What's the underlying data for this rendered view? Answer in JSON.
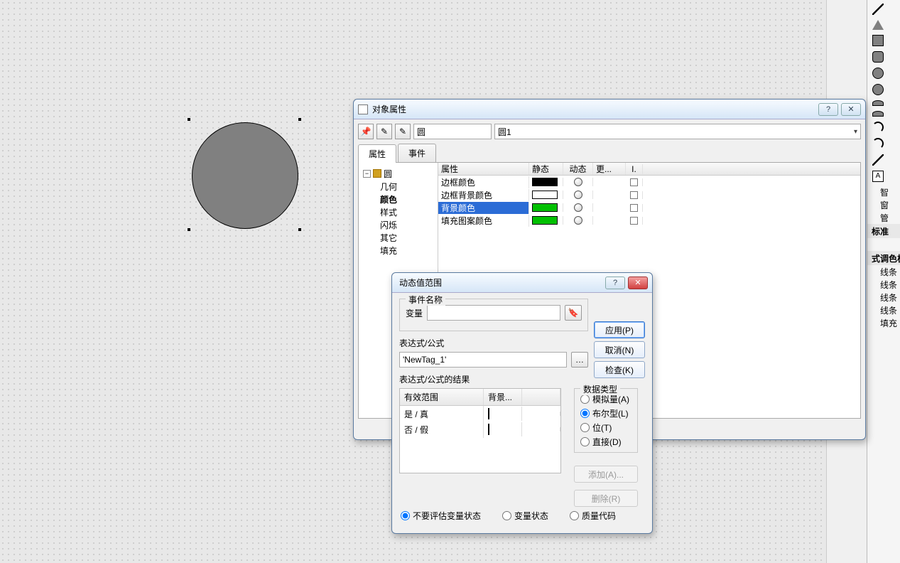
{
  "dlgProps": {
    "title": "对象属性",
    "objType": "圆",
    "objName": "圆1",
    "tabs": {
      "attr": "属性",
      "event": "事件"
    },
    "tree": {
      "root": "圆",
      "leaves": [
        "几何",
        "颜色",
        "样式",
        "闪烁",
        "其它",
        "填充"
      ],
      "selectedIndex": 1
    },
    "tableHead": {
      "prop": "属性",
      "static": "静态",
      "dyn": "动态",
      "more": "更...",
      "ind": "I."
    },
    "rows": [
      {
        "name": "边框颜色",
        "swatch": "sw-black",
        "selected": false
      },
      {
        "name": "边框背景颜色",
        "swatch": "sw-white",
        "selected": false
      },
      {
        "name": "背景颜色",
        "swatch": "sw-green",
        "selected": true
      },
      {
        "name": "填充图案颜色",
        "swatch": "sw-green",
        "selected": false
      }
    ]
  },
  "dlgDyn": {
    "title": "动态值范围",
    "eventNameLabel": "事件名称",
    "varLabel": "变量",
    "varValue": "",
    "exprLabel": "表达式/公式",
    "exprValue": "'NewTag_1'",
    "resultLegend": "表达式/公式的结果",
    "resHead": {
      "range": "有效范围",
      "bg": "背景..."
    },
    "resRows": [
      {
        "label": "是 / 真",
        "cls": "clr-red"
      },
      {
        "label": "否 / 假",
        "cls": "clr-green"
      }
    ],
    "dataTypeLegend": "数据类型",
    "dataTypes": {
      "analog": "模拟量(A)",
      "bool": "布尔型(L)",
      "bit": "位(T)",
      "direct": "直接(D)"
    },
    "dataTypeSelected": "bool",
    "btns": {
      "apply": "应用(P)",
      "cancel": "取消(N)",
      "check": "检查(K)",
      "add": "添加(A)...",
      "del": "删除(R)"
    },
    "bottom": {
      "noEval": "不要评估变量状态",
      "varStat": "变量状态",
      "qual": "质量代码",
      "selected": "noEval"
    }
  },
  "toolStrip": {
    "items": [
      "智",
      "窗",
      "管"
    ],
    "head": "标准",
    "paletteHead": "式调色板",
    "paletteRows": [
      "线条",
      "线条",
      "线条",
      "线条",
      "填充"
    ]
  }
}
